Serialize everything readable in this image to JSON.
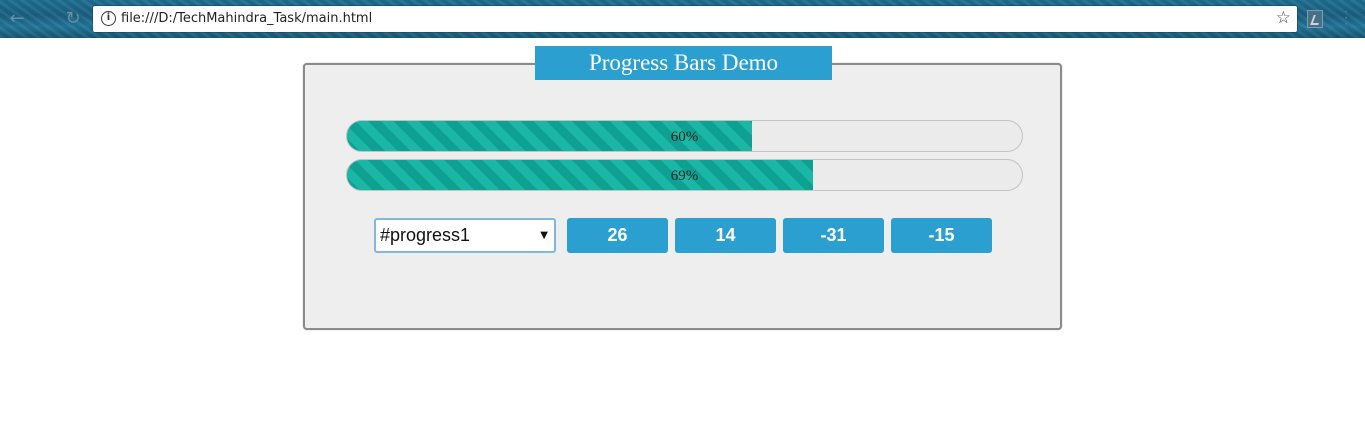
{
  "browser": {
    "url": "file:///D:/TechMahindra_Task/main.html",
    "back_icon": "back-arrow-icon",
    "reload_icon": "reload-icon",
    "info_icon": "info-icon",
    "star_icon": "bookmark-star-icon",
    "extension_icon": "extension-icon",
    "menu_icon": "menu-icon"
  },
  "panel": {
    "title": "Progress Bars Demo"
  },
  "progress_bars": [
    {
      "id": "#progress1",
      "value": 60,
      "label": "60%"
    },
    {
      "id": "#progress2",
      "value": 69,
      "label": "69%"
    }
  ],
  "controls": {
    "selected": "#progress1",
    "buttons": [
      "26",
      "14",
      "-31",
      "-15"
    ]
  },
  "colors": {
    "accent": "#2a9fd0",
    "progress_fill": "#16a897",
    "panel_bg": "#eeeeee"
  }
}
